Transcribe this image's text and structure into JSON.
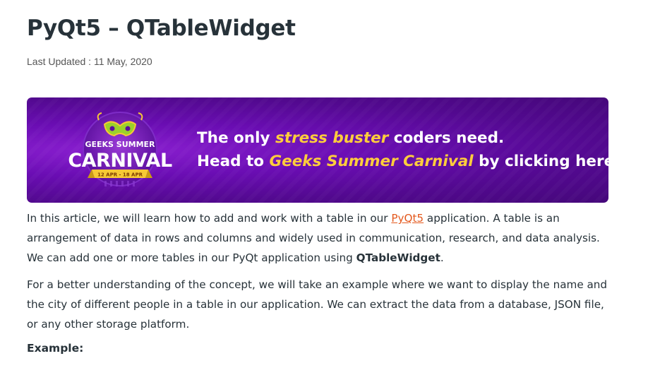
{
  "article": {
    "title": "PyQt5 – QTableWidget",
    "last_updated": "Last Updated : 11 May, 2020"
  },
  "banner": {
    "logo_top": "GEEKS SUMMER",
    "logo_main": "CARNIVAL",
    "logo_dates": "12 APR - 18 APR",
    "line1_a": "The only ",
    "line1_hl": "stress buster",
    "line1_b": " coders need.",
    "line2_a": "Head to ",
    "line2_hl": "Geeks Summer Carnival",
    "line2_b": " by clicking here!",
    "colors": {
      "background": "#6a0db3",
      "highlight": "#ffcd3c",
      "ribbon": "#f6c935"
    }
  },
  "paragraphs": {
    "p1_a": "In this article, we will learn how to add and work with a table in our ",
    "p1_link": "PyQt5",
    "p1_b": " application. A table is an arrangement of data in rows and columns and widely used in communication, research, and data analysis. We can add one or more tables in our PyQt application using ",
    "p1_bold": "QTableWidget",
    "p1_c": ".",
    "p2": "For a better understanding of the concept, we will take an example where we want to display the name and the city of different people in a table in our application. We can extract the data from a database, JSON file, or any other storage platform."
  },
  "example_label": "Example:",
  "accent_link_color": "#e4591e"
}
